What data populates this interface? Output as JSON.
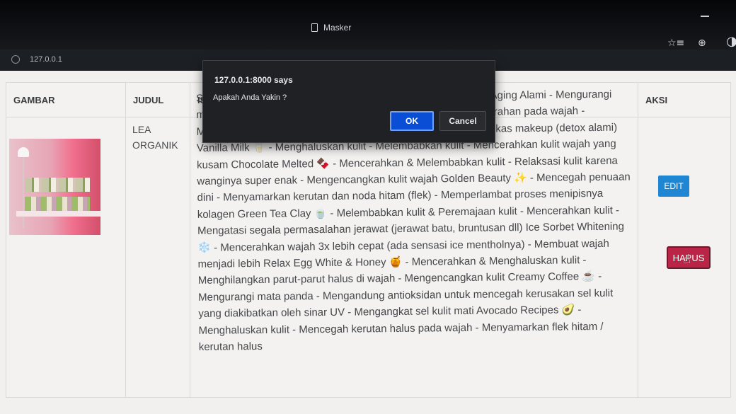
{
  "window": {
    "title": "Masker"
  },
  "address_bar": {
    "url": "127.0.0.1"
  },
  "toolbar_icons": {
    "favorites": "☆≡",
    "collections": "⊕",
    "profile": "◑"
  },
  "table": {
    "headers": {
      "gambar": "GAMBAR",
      "judul": "JUDUL",
      "isi": "ISI",
      "aksi": "AKSI"
    },
    "row": {
      "judul": "LEA ORGANIK",
      "isi": "Strawberry - Mencerahkan & Melembabkan Kulit Wajah & Anti Aging Alami - Mengurangi minyak berlebih Mud Mask Eksklusif 👽 - Menghilangkan kemerahan pada wajah - Menstimulasi sel kulit - Mengeluarkan racun pada wajah dari bekas makeup (detox alami) Vanilla Milk 🥛 - Menghaluskan kulit - Melembabkan kulit - Mencerahkan kulit wajah yang kusam Chocolate Melted 🍫 - Mencerahkan & Melembabkan kulit - Relaksasi kulit karena wanginya super enak - Mengencangkan kulit wajah Golden Beauty ✨ - Mencegah penuaan dini - Menyamarkan kerutan dan noda hitam (flek) - Memperlambat proses menipisnya kolagen Green Tea Clay 🍵 - Melembabkan kulit & Peremajaan kulit - Mencerahkan kulit - Mengatasi segala permasalahan jerawat (jerawat batu, bruntusan dll) Ice Sorbet Whitening ❄️ - Mencerahkan wajah 3x lebih cepat (ada sensasi ice mentholnya) - Membuat wajah menjadi lebih Relax Egg White & Honey 🍯 - Mencerahkan & Menghaluskan kulit - Menghilangkan parut-parut halus di wajah - Mengencangkan kulit Creamy Coffee ☕ - Mengurangi mata panda - Mengandung antioksidan untuk mencegah kerusakan sel kulit yang diakibatkan oleh sinar UV - Mengangkat sel kulit mati Avocado Recipes 🥑 - Menghaluskan kulit - Mencegah kerutan halus pada wajah - Menyamarkan flek hitam / kerutan halus",
      "edit_label": "EDIT",
      "hapus_label": "HAPUS"
    }
  },
  "alert": {
    "origin": "127.0.0.1:8000 says",
    "message": "Apakah Anda Yakin ?",
    "ok_label": "OK",
    "cancel_label": "Cancel"
  },
  "colors": {
    "edit_button": "#1f86d4",
    "hapus_button": "#ba2547",
    "ok_button": "#0b4ed6",
    "dialog_bg": "#202124"
  }
}
